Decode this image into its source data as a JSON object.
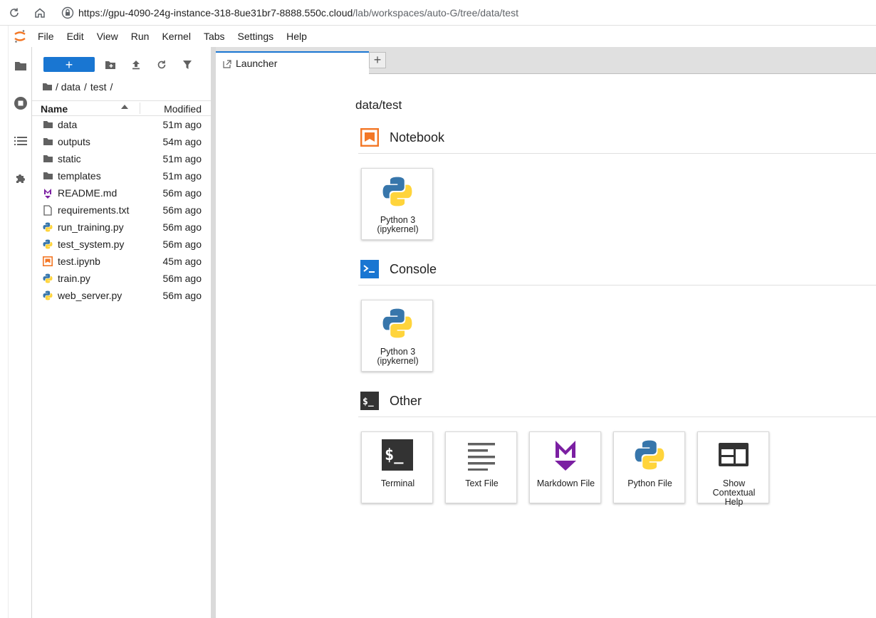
{
  "browser": {
    "url_host": "https://gpu-4090-24g-instance-318-8ue31br7-8888.550c.cloud",
    "url_path": "/lab/workspaces/auto-G/tree/data/test"
  },
  "menu": {
    "items": [
      "File",
      "Edit",
      "View",
      "Run",
      "Kernel",
      "Tabs",
      "Settings",
      "Help"
    ]
  },
  "filebrowser": {
    "new_label": "+",
    "breadcrumb": [
      "/ data",
      "/",
      "test",
      "/"
    ],
    "header": {
      "name": "Name",
      "modified": "Modified"
    },
    "files": [
      {
        "name": "data",
        "modified": "51m ago",
        "icon": "folder-icon"
      },
      {
        "name": "outputs",
        "modified": "54m ago",
        "icon": "folder-icon"
      },
      {
        "name": "static",
        "modified": "51m ago",
        "icon": "folder-icon"
      },
      {
        "name": "templates",
        "modified": "51m ago",
        "icon": "folder-icon"
      },
      {
        "name": "README.md",
        "modified": "56m ago",
        "icon": "markdown-icon"
      },
      {
        "name": "requirements.txt",
        "modified": "56m ago",
        "icon": "text-file-icon"
      },
      {
        "name": "run_training.py",
        "modified": "56m ago",
        "icon": "python-icon"
      },
      {
        "name": "test_system.py",
        "modified": "56m ago",
        "icon": "python-icon"
      },
      {
        "name": "test.ipynb",
        "modified": "45m ago",
        "icon": "notebook-icon"
      },
      {
        "name": "train.py",
        "modified": "56m ago",
        "icon": "python-icon"
      },
      {
        "name": "web_server.py",
        "modified": "56m ago",
        "icon": "python-icon"
      }
    ]
  },
  "tabs": {
    "active": "Launcher",
    "add": "+"
  },
  "launcher": {
    "cwd": "data/test",
    "sections": {
      "notebook": {
        "title": "Notebook",
        "cards": [
          {
            "line1": "Python 3",
            "line2": "(ipykernel)"
          }
        ]
      },
      "console": {
        "title": "Console",
        "cards": [
          {
            "line1": "Python 3",
            "line2": "(ipykernel)"
          }
        ]
      },
      "other": {
        "title": "Other",
        "cards": [
          {
            "line1": "Terminal"
          },
          {
            "line1": "Text File"
          },
          {
            "line1": "Markdown File"
          },
          {
            "line1": "Python File"
          },
          {
            "line1": "Show",
            "line2": "Contextual",
            "line3": "Help"
          }
        ]
      }
    }
  },
  "colors": {
    "accent": "#1976d2",
    "notebook_orange": "#f37726",
    "markdown_purple": "#7b1fa2"
  }
}
